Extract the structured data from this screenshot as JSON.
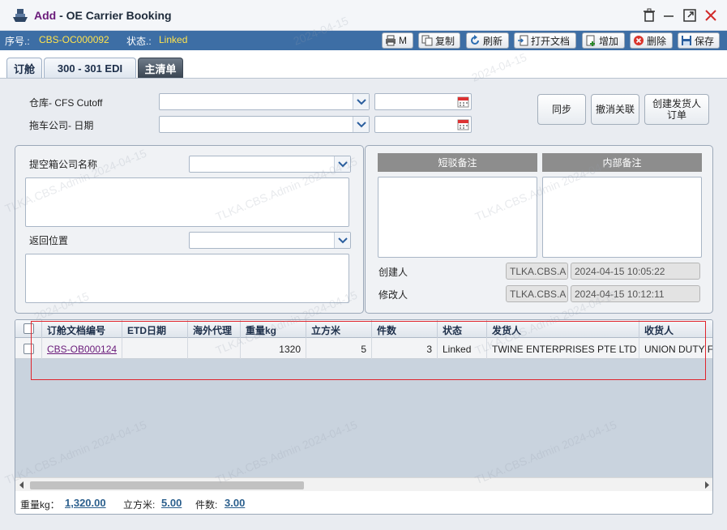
{
  "window": {
    "add": "Add",
    "title": "- OE Carrier Booking"
  },
  "info": {
    "serial_label": "序号.:",
    "serial_value": "CBS-OC000092",
    "status_label": "状态.:",
    "status_value": "Linked"
  },
  "toolbar": {
    "print": "M",
    "copy": "复制",
    "refresh": "刷新",
    "open_doc": "打开文档",
    "add": "增加",
    "delete": "删除",
    "save": "保存"
  },
  "tabs": [
    "订舱",
    "300 - 301 EDI",
    "主清单"
  ],
  "form": {
    "warehouse_label": "仓库- CFS Cutoff",
    "trucker_label": "拖车公司- 日期",
    "pickup_label": "提空箱公司名称",
    "return_label": "返回位置"
  },
  "buttons": {
    "sync": "同步",
    "unlink": "撤消关联",
    "create_order": "创建发货人订单"
  },
  "remarks": {
    "short_header": "短驳备注",
    "internal_header": "内部备注"
  },
  "audit": {
    "creator_label": "创建人",
    "creator_name": "TLKA.CBS.A",
    "creator_time": "2024-04-15 10:05:22",
    "modifier_label": "修改人",
    "modifier_name": "TLKA.CBS.A",
    "modifier_time": "2024-04-15 10:12:11"
  },
  "grid": {
    "columns": [
      "订舱文档编号",
      "ETD日期",
      "海外代理",
      "重量kg",
      "立方米",
      "件数",
      "状态",
      "发货人",
      "收货人"
    ],
    "rows": [
      {
        "doc_no": "CBS-OB000124",
        "etd": "",
        "agent": "",
        "weight": "1320",
        "cbm": "5",
        "pieces": "3",
        "status": "Linked",
        "shipper": "TWINE ENTERPRISES PTE LTD",
        "consignee": "UNION DUTY FI"
      }
    ]
  },
  "totals": {
    "weight_label": "重量kg：",
    "weight_value": "1,320.00",
    "cbm_label": "立方米:",
    "cbm_value": "5.00",
    "pieces_label": "件数:",
    "pieces_value": "3.00"
  },
  "watermarks": [
    "2024-04-15",
    "TLKA.CBS.Admin 2024-04-15"
  ],
  "colors": {
    "info_bar": "#3d6ea5",
    "status_value": "#ffe34d",
    "link": "#6a1b7a",
    "highlight_box": "#e0242c"
  }
}
